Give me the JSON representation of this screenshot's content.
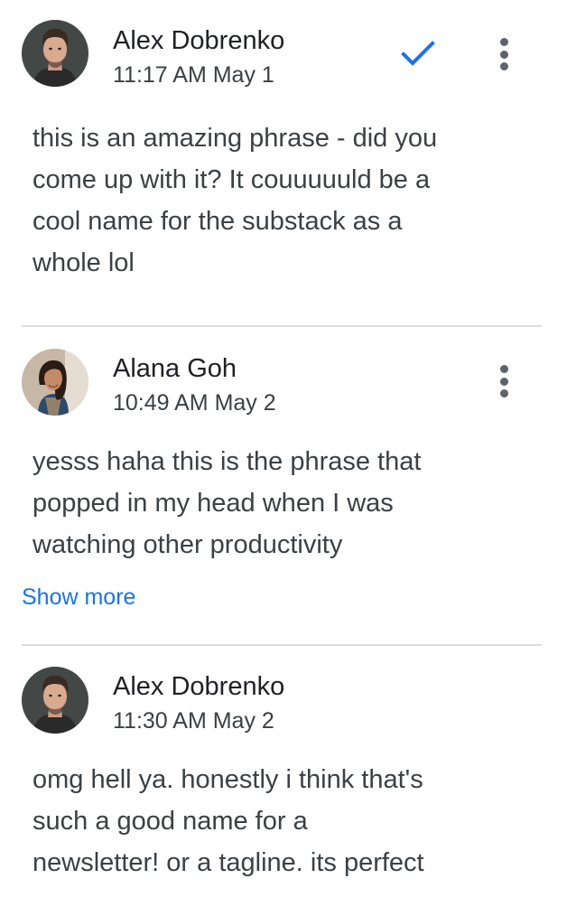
{
  "comments": [
    {
      "author": "Alex Dobrenko",
      "time": "11:17 AM May 1",
      "lines": [
        "this is an amazing phrase - did you",
        "come up with it? It couuuuuld be a",
        "cool name for the substack as a",
        "whole lol"
      ],
      "avatar_icon": "man-portrait-avatar",
      "actions": [
        "resolve-check-icon",
        "more-vert-icon"
      ]
    },
    {
      "author": "Alana Goh",
      "time": "10:49 AM May 2",
      "lines": [
        "yesss haha this is the phrase that",
        "popped in my head when I was",
        "watching other productivity"
      ],
      "show_more": "Show more",
      "avatar_icon": "woman-portrait-avatar",
      "actions": [
        "more-vert-icon"
      ]
    },
    {
      "author": "Alex Dobrenko",
      "time": "11:30 AM May 2",
      "lines": [
        "omg hell ya. honestly i think that's",
        "such a good name for a",
        "newsletter! or a tagline. its perfect"
      ],
      "avatar_icon": "man-portrait-avatar",
      "actions": []
    }
  ],
  "colors": {
    "accent_blue": "#1a73e8",
    "divider": "#dadce0",
    "text_primary": "#202124",
    "text_secondary": "#3c4043",
    "icon_gray": "#5f6368"
  }
}
